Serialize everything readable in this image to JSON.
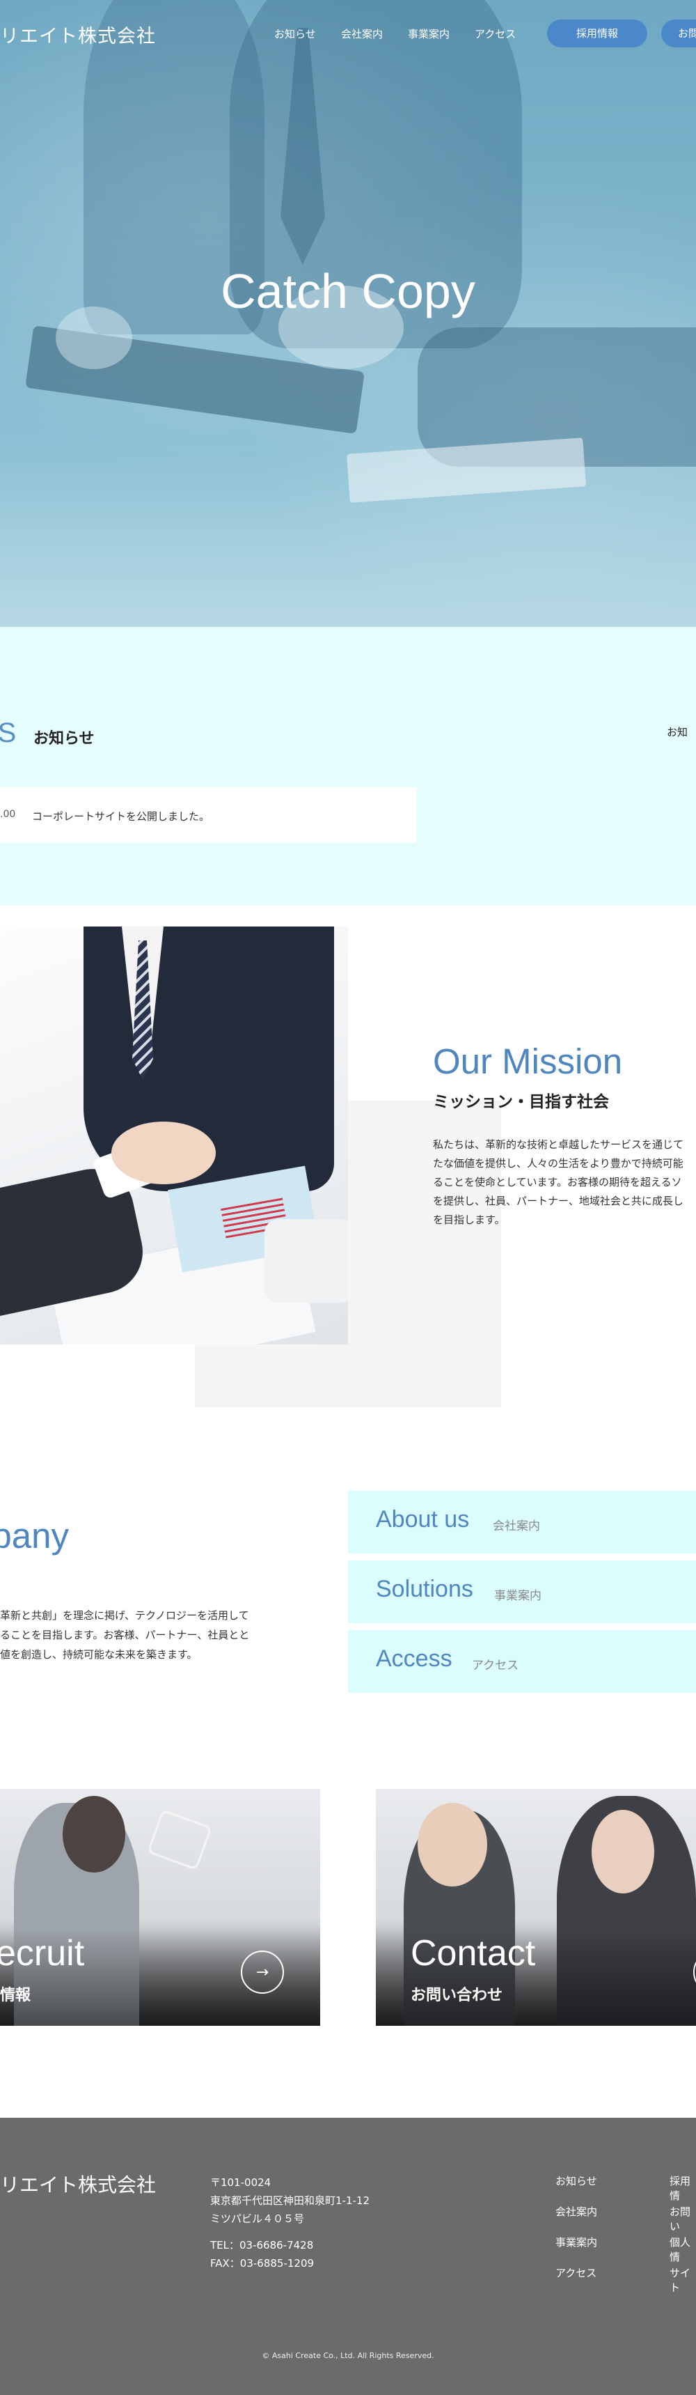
{
  "header": {
    "logo": "リエイト株式会社",
    "nav": [
      "お知らせ",
      "会社案内",
      "事業案内",
      "アクセス"
    ],
    "recruit_button": "採用情報",
    "contact_button": "お問"
  },
  "hero": {
    "catch_copy": "Catch Copy"
  },
  "news": {
    "title_en": "VS",
    "title_jp": "お知らせ",
    "more_label": "お知",
    "items": [
      {
        "date": ".00",
        "text": "コーポレートサイトを公開しました。"
      }
    ]
  },
  "mission": {
    "title_en": "Our Mission",
    "title_jp": "ミッション・目指す社会",
    "body": [
      "私たちは、革新的な技術と卓越したサービスを通じて",
      "たな価値を提供し、人々の生活をより豊かで持続可能",
      "ることを使命としています。お客様の期待を超えるソ",
      "を提供し、社員、パートナー、地域社会と共に成長し",
      "を目指します。"
    ]
  },
  "company": {
    "title_en": "npany",
    "body": [
      "革新と共創」を理念に掲げ、テクノロジーを活用して",
      "ることを目指します。お客様、パートナー、社員とと",
      "値を創造し、持続可能な未来を築きます。"
    ],
    "links": [
      {
        "en": "About us",
        "jp": "会社案内"
      },
      {
        "en": "Solutions",
        "jp": "事業案内"
      },
      {
        "en": "Access",
        "jp": "アクセス"
      }
    ]
  },
  "banners": {
    "recruit": {
      "en": "ecruit",
      "jp": "情報",
      "arrow": "→"
    },
    "contact": {
      "en": "Contact",
      "jp": "お問い合わせ"
    }
  },
  "footer": {
    "logo": "リエイト株式会社",
    "address": [
      "〒101-0024",
      "東京都千代田区神田和泉町1-1-12",
      "ミツパビル４０５号"
    ],
    "tel": "TEL：03-6686-7428",
    "fax": "FAX：03-6885-1209",
    "links_col1": [
      "お知らせ",
      "会社案内",
      "事業案内",
      "アクセス"
    ],
    "links_col2": [
      "採用情",
      "お問い",
      "個人情",
      "サイト"
    ],
    "copyright": "© Asahi Create Co., Ltd. All Rights Reserved."
  },
  "colors": {
    "accent_blue": "#4b88c9",
    "news_bg": "#e6fdfe",
    "link_card_bg": "#dcfdfe",
    "footer_bg": "#6b6b6b"
  }
}
